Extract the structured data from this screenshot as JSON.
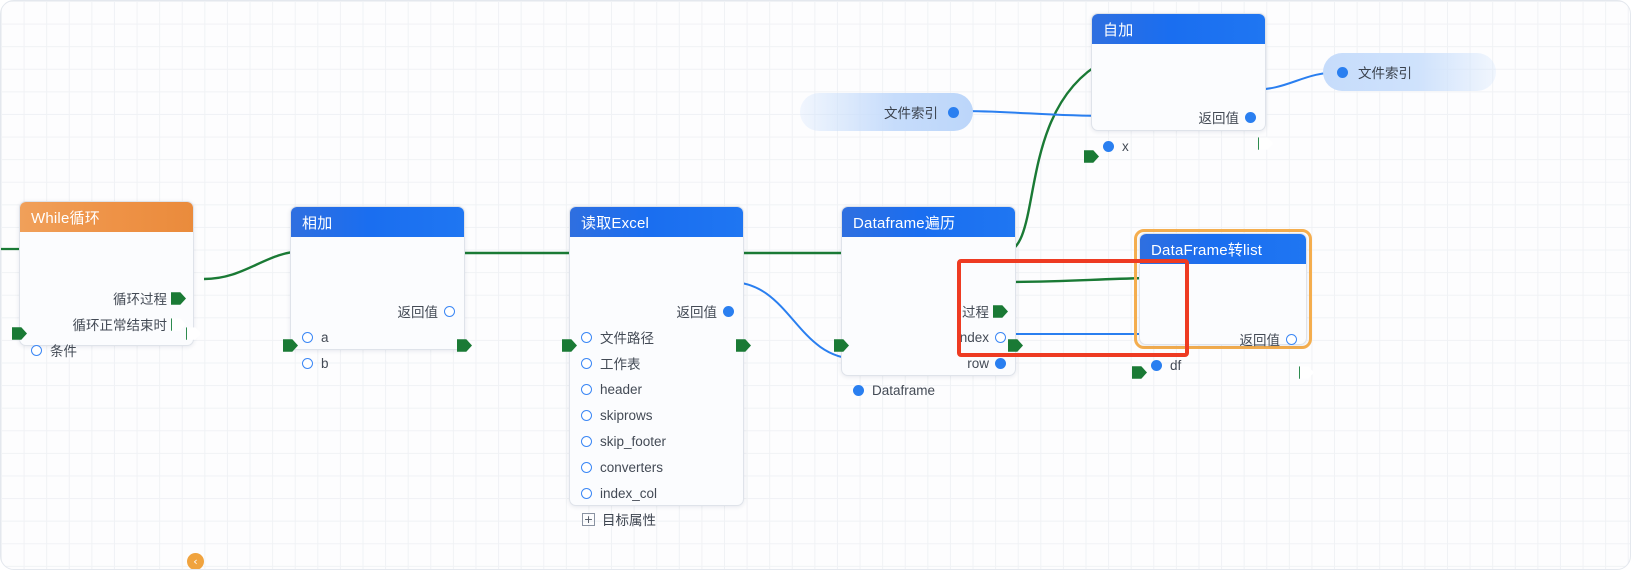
{
  "canvas": {
    "title": "visual-workflow-canvas",
    "grid": true,
    "accent_blue": "#1f76f2",
    "accent_orange": "#ee9246",
    "exec_wire_color": "#1a7a35",
    "data_wire_color": "#2a7ff0",
    "annotation_red": "#ee3b22",
    "annotation_orange": "#f5ae4e"
  },
  "nodes": [
    {
      "id": "while-loop",
      "title": "While循环",
      "header_style": "orange",
      "exec_in": "",
      "exec_out_top": "",
      "outputs": [
        {
          "label": "循环过程",
          "kind": "exec",
          "filled": true,
          "badge": "‹"
        },
        {
          "label": "循环正常结束时",
          "kind": "exec",
          "filled": false
        }
      ],
      "inputs": [
        {
          "label": "条件",
          "kind": "data"
        }
      ]
    },
    {
      "id": "add",
      "title": "相加",
      "header_style": "blue",
      "outputs": [
        {
          "label": "返回值",
          "kind": "data"
        }
      ],
      "inputs": [
        {
          "label": "a",
          "kind": "data"
        },
        {
          "label": "b",
          "kind": "data"
        }
      ]
    },
    {
      "id": "read-excel",
      "title": "读取Excel",
      "header_style": "blue",
      "outputs": [
        {
          "label": "返回值",
          "kind": "data",
          "filled": true
        }
      ],
      "inputs": [
        {
          "label": "文件路径",
          "kind": "data"
        },
        {
          "label": "工作表",
          "kind": "data"
        },
        {
          "label": "header",
          "kind": "data"
        },
        {
          "label": "skiprows",
          "kind": "data"
        },
        {
          "label": "skip_footer",
          "kind": "data"
        },
        {
          "label": "converters",
          "kind": "data"
        },
        {
          "label": "index_col",
          "kind": "data"
        }
      ],
      "expandable": {
        "label": "目标属性",
        "icon": "plus-box"
      }
    },
    {
      "id": "dataframe-iterate",
      "title": "Dataframe遍历",
      "header_style": "blue",
      "outputs": [
        {
          "label": "过程",
          "kind": "exec",
          "filled": true
        },
        {
          "label": "index",
          "kind": "data"
        },
        {
          "label": "row",
          "kind": "data",
          "filled": true
        }
      ],
      "inputs": [
        {
          "label": "Dataframe",
          "kind": "data",
          "filled": true
        }
      ]
    },
    {
      "id": "dataframe-to-list",
      "title": "DataFrame转list",
      "header_style": "blue",
      "highlighted": true,
      "outputs": [
        {
          "label": "返回值",
          "kind": "data"
        }
      ],
      "inputs": [
        {
          "label": "df",
          "kind": "data",
          "filled": true
        }
      ]
    },
    {
      "id": "self-increment",
      "title": "自加",
      "header_style": "blue",
      "outputs": [
        {
          "label": "返回值",
          "kind": "data",
          "filled": true
        }
      ],
      "inputs": [
        {
          "label": "x",
          "kind": "data",
          "filled": true
        }
      ]
    }
  ],
  "variable_pills": [
    {
      "id": "file-index-get",
      "label": "文件索引",
      "direction": "out"
    },
    {
      "id": "file-index-set",
      "label": "文件索引",
      "direction": "in"
    }
  ],
  "annotations": [
    {
      "id": "red-highlight-box",
      "color": "#ee3b22",
      "shape": "rectangle"
    },
    {
      "id": "orange-node-highlight",
      "color": "#f5ae4e",
      "shape": "rounded-rectangle"
    }
  ]
}
